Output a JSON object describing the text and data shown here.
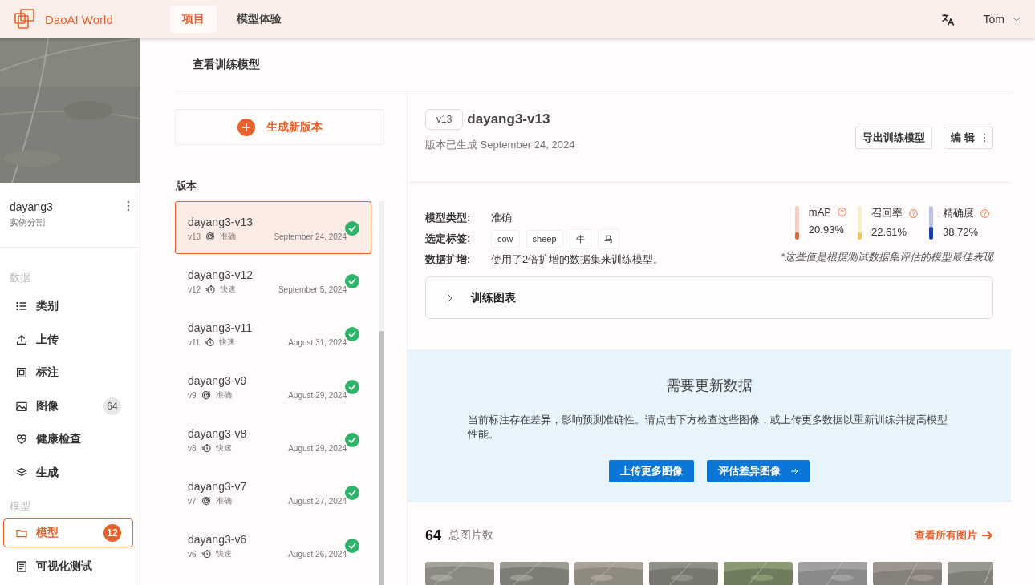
{
  "header": {
    "brand": "DaoAI World",
    "nav": [
      {
        "label": "项目",
        "selected": true
      },
      {
        "label": "模型体验",
        "selected": false
      }
    ],
    "user": "Tom"
  },
  "sidebar": {
    "project": {
      "name": "dayang3",
      "type": "实例分割"
    },
    "groups": [
      {
        "label": "数据",
        "items": [
          {
            "label": "类别",
            "selected": false
          },
          {
            "label": "上传",
            "selected": false
          },
          {
            "label": "标注",
            "selected": false
          },
          {
            "label": "图像",
            "badge": "64",
            "selected": false
          },
          {
            "label": "健康检查",
            "selected": false
          },
          {
            "label": "生成",
            "selected": false
          }
        ]
      },
      {
        "label": "模型",
        "items": [
          {
            "label": "模型",
            "badge": "12",
            "selected": true
          },
          {
            "label": "可视化测试",
            "selected": false
          }
        ]
      }
    ]
  },
  "page_tab": "查看训练模型",
  "new_version": "生成新版本",
  "versions_label": "版本",
  "versions": [
    {
      "name": "dayang3-v13",
      "short": "v13",
      "kind": "accurate",
      "mode": "准确",
      "date": "September 24, 2024",
      "selected": true,
      "done": true
    },
    {
      "name": "dayang3-v12",
      "short": "v12",
      "kind": "fast",
      "mode": "快速",
      "date": "September 5, 2024",
      "selected": false,
      "done": true
    },
    {
      "name": "dayang3-v11",
      "short": "v11",
      "kind": "fast",
      "mode": "快速",
      "date": "August 31, 2024",
      "selected": false,
      "done": true
    },
    {
      "name": "dayang3-v9",
      "short": "v9",
      "kind": "accurate",
      "mode": "准确",
      "date": "August 29, 2024",
      "selected": false,
      "done": true
    },
    {
      "name": "dayang3-v8",
      "short": "v8",
      "kind": "fast",
      "mode": "快速",
      "date": "August 29, 2024",
      "selected": false,
      "done": true
    },
    {
      "name": "dayang3-v7",
      "short": "v7",
      "kind": "accurate",
      "mode": "准确",
      "date": "August 27, 2024",
      "selected": false,
      "done": true
    },
    {
      "name": "dayang3-v6",
      "short": "v6",
      "kind": "fast",
      "mode": "快速",
      "date": "August 26, 2024",
      "selected": false,
      "done": true
    }
  ],
  "detail": {
    "version_tag": "v13",
    "title": "dayang3-v13",
    "generated": "版本已生成 September 24, 2024",
    "export_button": "导出训练模型",
    "edit_button": "编 辑",
    "fields": [
      {
        "label": "模型类型:",
        "kind": "text",
        "value": "准确"
      },
      {
        "label": "选定标签:",
        "kind": "tags",
        "tags": [
          "cow",
          "sheep",
          "牛",
          "马"
        ]
      },
      {
        "label": "数据扩增:",
        "kind": "text",
        "value": "使用了2倍扩增的数据集来训练模型。"
      }
    ],
    "metrics": [
      {
        "name": "mAP",
        "value": "20.93%",
        "level": 0.2093,
        "color": "#e8602c"
      },
      {
        "name": "召回率",
        "value": "22.61%",
        "level": 0.2261,
        "color": "#f2c94c"
      },
      {
        "name": "精确度",
        "value": "38.72%",
        "level": 0.3872,
        "color": "#1f3fa8"
      }
    ],
    "note": "*这些值是根据测试数据集评估的模型最佳表现",
    "chart_section": {
      "title": "训练图表",
      "expanded": false
    }
  },
  "notice": {
    "title": "需要更新数据",
    "text": "当前标注存在差异，影响预测准确性。请点击下方检查这些图像，或上传更多数据以重新训练并提高模型性能。",
    "buttons": [
      "上传更多图像",
      "评估差异图像"
    ]
  },
  "images": {
    "count": "64",
    "label": "总图片数",
    "link": "查看所有图片"
  }
}
